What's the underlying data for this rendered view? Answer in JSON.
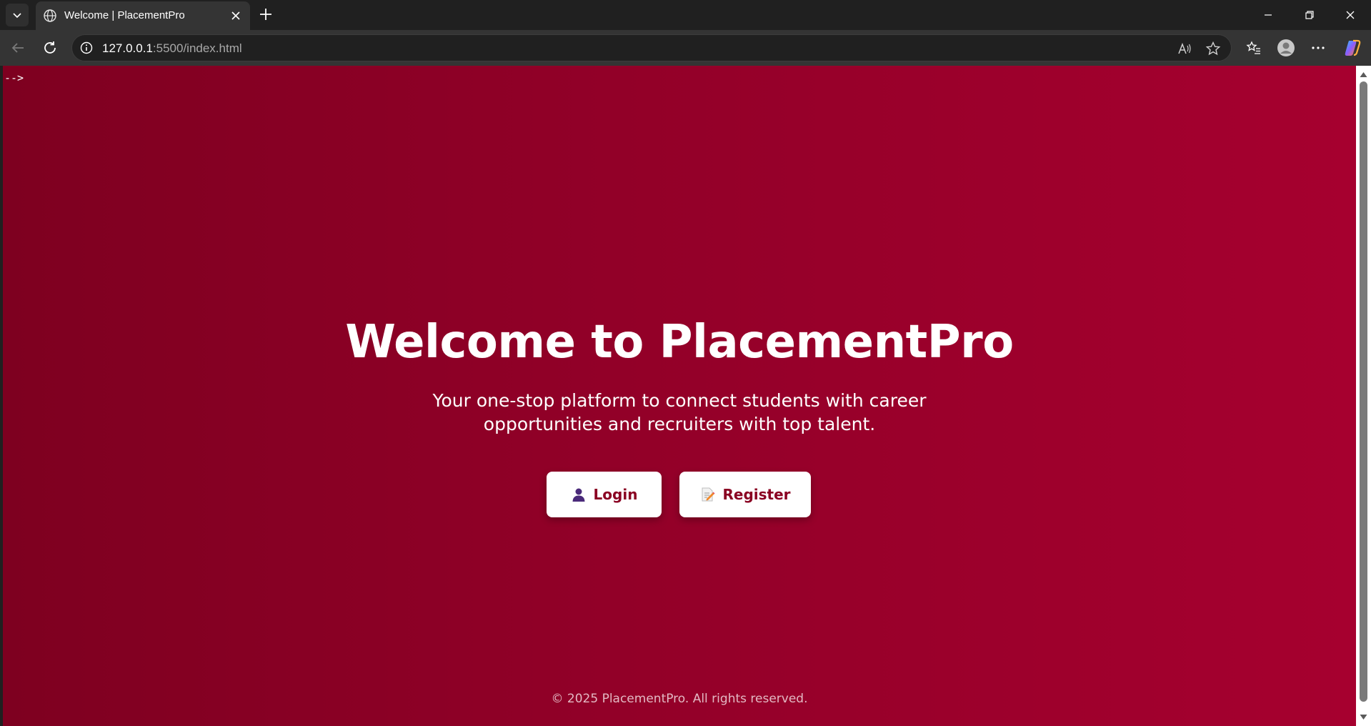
{
  "browser": {
    "tab": {
      "title": "Welcome | PlacementPro"
    },
    "address": {
      "host": "127.0.0.1",
      "path": ":5500/index.html"
    },
    "icons": {
      "tab_list": "chevron-down-icon",
      "tab_favicon": "globe-icon",
      "tab_close": "close-icon",
      "new_tab": "plus-icon",
      "minimize": "minimize-icon",
      "restore": "restore-icon",
      "close_window": "close-icon",
      "back": "back-arrow-icon",
      "refresh": "refresh-icon",
      "site_info": "info-icon",
      "read_aloud": "read-aloud-icon",
      "favorite": "star-icon",
      "favorites": "favorites-icon",
      "profile": "profile-icon",
      "more": "more-icon",
      "copilot": "copilot-icon"
    }
  },
  "page": {
    "stray_text": "-->",
    "hero": {
      "title": "Welcome to PlacementPro",
      "subtitle": "Your one-stop platform to connect students with career opportunities and recruiters with top talent."
    },
    "buttons": {
      "login": {
        "label": "Login",
        "icon": "user-icon"
      },
      "register": {
        "label": "Register",
        "icon": "memo-icon"
      }
    },
    "footer": "© 2025 PlacementPro. All rights reserved."
  },
  "colors": {
    "gradient_start": "#7e0020",
    "gradient_end": "#a6002f",
    "button_text": "#8a0022",
    "button_bg": "#ffffff"
  }
}
